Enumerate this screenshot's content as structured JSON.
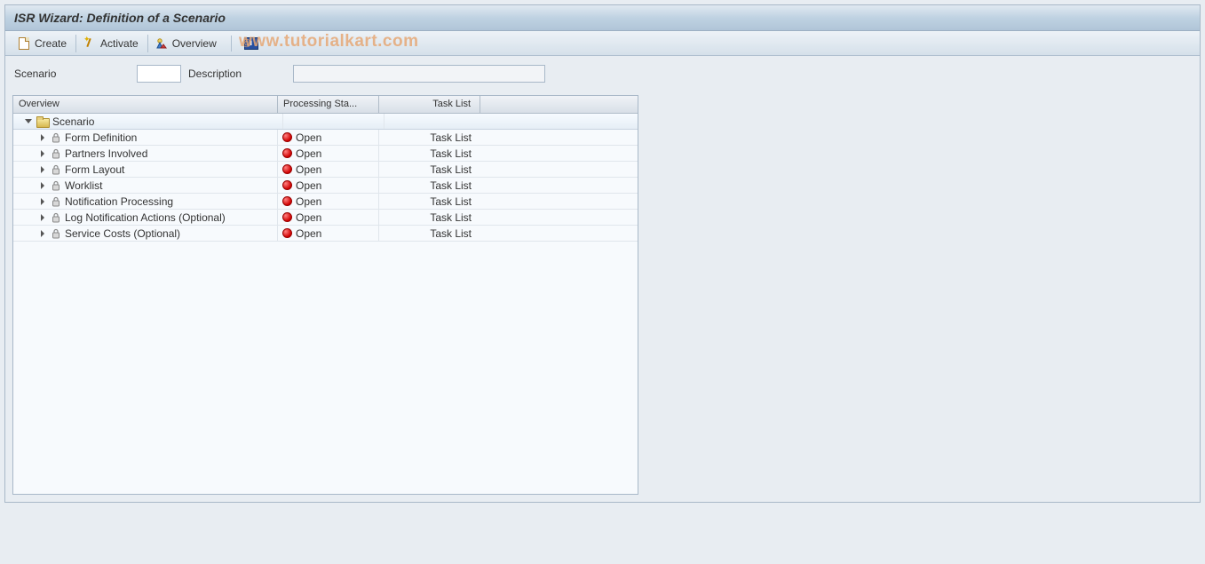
{
  "header": {
    "title": "ISR Wizard: Definition of a Scenario"
  },
  "toolbar": {
    "create": "Create",
    "activate": "Activate",
    "overview": "Overview"
  },
  "watermark": "www.tutorialkart.com",
  "form": {
    "scenario_label": "Scenario",
    "scenario_value": "",
    "description_label": "Description",
    "description_value": ""
  },
  "tree": {
    "columns": {
      "overview": "Overview",
      "status": "Processing Sta...",
      "tasklist": "Task List"
    },
    "root": {
      "label": "Scenario"
    },
    "rows": [
      {
        "label": "Form Definition",
        "status": "Open",
        "tasklist": "Task List"
      },
      {
        "label": "Partners Involved",
        "status": "Open",
        "tasklist": "Task List"
      },
      {
        "label": "Form Layout",
        "status": "Open",
        "tasklist": "Task List"
      },
      {
        "label": "Worklist",
        "status": "Open",
        "tasklist": "Task List"
      },
      {
        "label": "Notification Processing",
        "status": "Open",
        "tasklist": "Task List"
      },
      {
        "label": "Log Notification Actions (Optional)",
        "status": "Open",
        "tasklist": "Task List"
      },
      {
        "label": "Service Costs (Optional)",
        "status": "Open",
        "tasklist": "Task List"
      }
    ]
  }
}
